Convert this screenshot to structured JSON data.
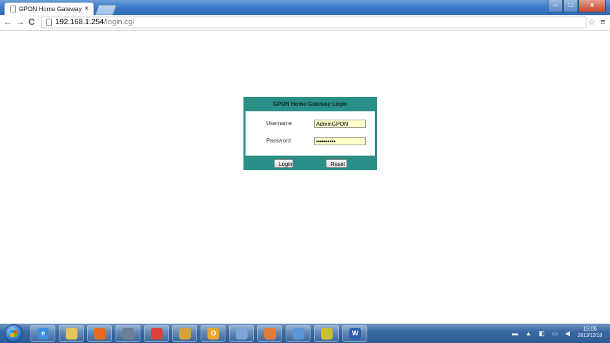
{
  "browser": {
    "tab_title": "GPON Home Gateway",
    "tab_close": "×",
    "url_host": "192.168.1.254",
    "url_path": "/login.cgi",
    "window_controls": {
      "minimize": "–",
      "maximize": "□",
      "close": "x"
    },
    "nav": {
      "back": "←",
      "forward": "→",
      "reload": "C",
      "star": "☆",
      "menu": "≡"
    }
  },
  "login": {
    "header": "GPON Home Gateway Login",
    "username_label": "Username",
    "username_value": "AdminGPON",
    "password_label": "Password",
    "password_value": "••••••••••",
    "login_button": "Login",
    "reset_button": "Reset",
    "panel_color": "#2a8f86",
    "input_color": "#ffffc8"
  },
  "taskbar": {
    "apps": [
      {
        "name": "internet-explorer",
        "glyph": "e",
        "color": "#3b8fdc"
      },
      {
        "name": "file-explorer",
        "glyph": "",
        "color": "#e8c35a"
      },
      {
        "name": "firefox",
        "glyph": "",
        "color": "#e56b1f"
      },
      {
        "name": "calculator",
        "glyph": "",
        "color": "#6b7f95"
      },
      {
        "name": "chrome",
        "glyph": "",
        "color": "#d9433a"
      },
      {
        "name": "notes-app",
        "glyph": "",
        "color": "#d5a23b"
      },
      {
        "name": "outlook",
        "glyph": "O",
        "color": "#e8a72b"
      },
      {
        "name": "network-app",
        "glyph": "",
        "color": "#7aa7d8"
      },
      {
        "name": "user-app",
        "glyph": "",
        "color": "#e17c3c"
      },
      {
        "name": "search-app",
        "glyph": "",
        "color": "#5a96d6"
      },
      {
        "name": "media-app",
        "glyph": "",
        "color": "#c9c030"
      },
      {
        "name": "word",
        "glyph": "W",
        "color": "#2b5fb0"
      }
    ],
    "clock_time": "15:05",
    "clock_date": "2013/12/18"
  }
}
